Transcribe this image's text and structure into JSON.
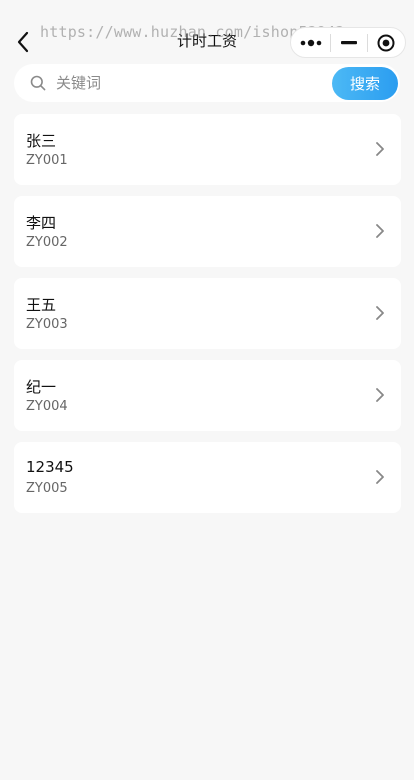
{
  "navbar": {
    "title": "计时工资",
    "watermark": "https://www.huzhan.com/ishop52942"
  },
  "search": {
    "placeholder": "关键词",
    "value": "",
    "button_label": "搜索"
  },
  "employees": [
    {
      "name": "张三",
      "code": "ZY001"
    },
    {
      "name": "李四",
      "code": "ZY002"
    },
    {
      "name": "王五",
      "code": "ZY003"
    },
    {
      "name": "纪一",
      "code": "ZY004"
    },
    {
      "name": "12345",
      "code": "ZY005"
    }
  ],
  "icons": {
    "back": "back-arrow-icon",
    "more": "more-dots-icon",
    "minimize": "minimize-icon",
    "close": "close-target-icon",
    "search": "search-icon",
    "chevron": "chevron-right-icon"
  },
  "colors": {
    "background": "#f7f7f7",
    "card": "#ffffff",
    "accent_start": "#4cb9f5",
    "accent_end": "#2b9df0"
  }
}
